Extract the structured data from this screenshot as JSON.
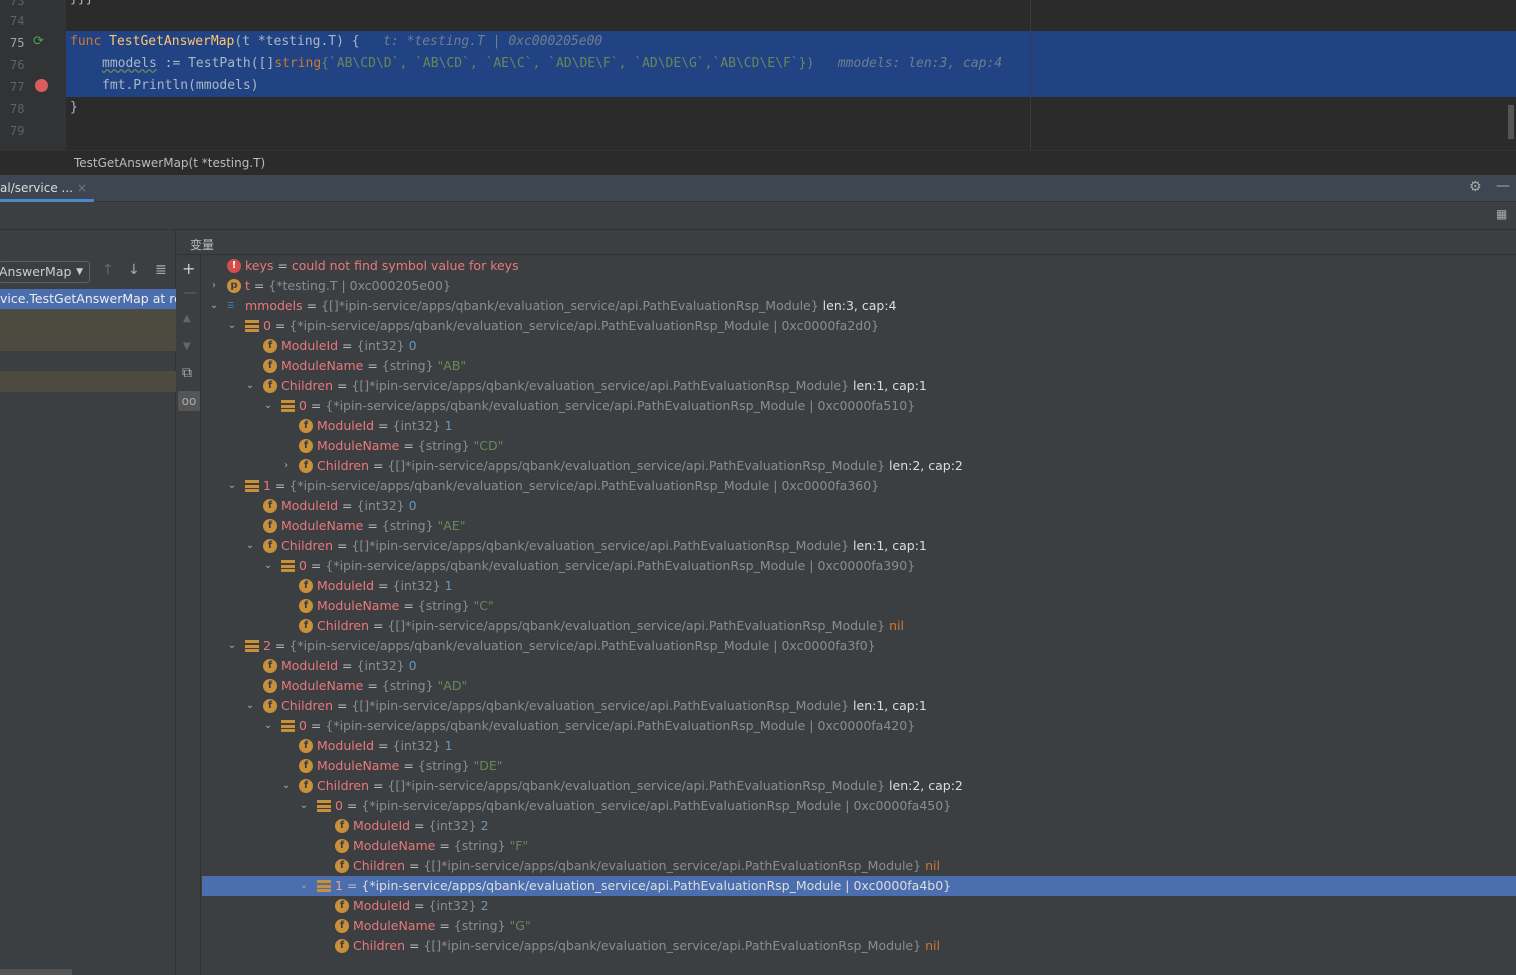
{
  "editor": {
    "lines": [
      {
        "n": "73"
      },
      {
        "n": "74"
      },
      {
        "n": "75"
      },
      {
        "n": "76"
      },
      {
        "n": "77"
      },
      {
        "n": "78"
      },
      {
        "n": "79"
      }
    ],
    "line75": {
      "kw": "func",
      "fn": "TestGetAnswerMap",
      "params": "(t *testing.T) {",
      "hint": "t: *testing.T | 0xc000205e00"
    },
    "line76": {
      "var": "mmodels",
      "op": " := TestPath([]",
      "type": "string",
      "args": "{`AB\\CD\\D`, `AB\\CD`, `AE\\C`, `AD\\DE\\F`, `AD\\DE\\G`,`AB\\CD\\E\\F`})",
      "hint": "mmodels: len:3, cap:4"
    },
    "line77": "fmt.Println(mmodels)",
    "line78": "}",
    "line73": "}}}"
  },
  "breadcrumb": "TestGetAnswerMap(t *testing.T)",
  "tab": {
    "label": "al/service ..."
  },
  "frames": {
    "thread": "AnswerMap",
    "selected_frame": "vice.TestGetAnswerMap at red"
  },
  "variables": {
    "header": "变量",
    "rows": [
      {
        "l": 0,
        "e": "none",
        "icon": "err",
        "name": "keys",
        "err": "could not find symbol value for keys"
      },
      {
        "l": 0,
        "e": "closed",
        "icon": "p",
        "name": "t",
        "type": "{*testing.T | 0xc000205e00}"
      },
      {
        "l": 0,
        "e": "open",
        "icon": "list",
        "name": "mmodels",
        "type": "{[]*ipin-service/apps/qbank/evaluation_service/api.PathEvaluationRsp_Module}",
        "extra": " len:3, cap:4"
      },
      {
        "l": 1,
        "e": "open",
        "icon": "struct",
        "name": "0",
        "type": "{*ipin-service/apps/qbank/evaluation_service/api.PathEvaluationRsp_Module | 0xc0000fa2d0}"
      },
      {
        "l": 2,
        "e": "none",
        "icon": "f",
        "name": "ModuleId",
        "type": "{int32} ",
        "value": "0",
        "vk": "vnum"
      },
      {
        "l": 2,
        "e": "none",
        "icon": "f",
        "name": "ModuleName",
        "type": "{string} ",
        "value": "\"AB\"",
        "vk": "vstr"
      },
      {
        "l": 2,
        "e": "open",
        "icon": "f",
        "name": "Children",
        "type": "{[]*ipin-service/apps/qbank/evaluation_service/api.PathEvaluationRsp_Module}",
        "extra": " len:1, cap:1"
      },
      {
        "l": 3,
        "e": "open",
        "icon": "struct",
        "name": "0",
        "type": "{*ipin-service/apps/qbank/evaluation_service/api.PathEvaluationRsp_Module | 0xc0000fa510}"
      },
      {
        "l": 4,
        "e": "none",
        "icon": "f",
        "name": "ModuleId",
        "type": "{int32} ",
        "value": "1",
        "vk": "vnum"
      },
      {
        "l": 4,
        "e": "none",
        "icon": "f",
        "name": "ModuleName",
        "type": "{string} ",
        "value": "\"CD\"",
        "vk": "vstr"
      },
      {
        "l": 4,
        "e": "closed",
        "icon": "f",
        "name": "Children",
        "type": "{[]*ipin-service/apps/qbank/evaluation_service/api.PathEvaluationRsp_Module}",
        "extra": " len:2, cap:2"
      },
      {
        "l": 1,
        "e": "open",
        "icon": "struct",
        "name": "1",
        "type": "{*ipin-service/apps/qbank/evaluation_service/api.PathEvaluationRsp_Module | 0xc0000fa360}"
      },
      {
        "l": 2,
        "e": "none",
        "icon": "f",
        "name": "ModuleId",
        "type": "{int32} ",
        "value": "0",
        "vk": "vnum"
      },
      {
        "l": 2,
        "e": "none",
        "icon": "f",
        "name": "ModuleName",
        "type": "{string} ",
        "value": "\"AE\"",
        "vk": "vstr"
      },
      {
        "l": 2,
        "e": "open",
        "icon": "f",
        "name": "Children",
        "type": "{[]*ipin-service/apps/qbank/evaluation_service/api.PathEvaluationRsp_Module}",
        "extra": " len:1, cap:1"
      },
      {
        "l": 3,
        "e": "open",
        "icon": "struct",
        "name": "0",
        "type": "{*ipin-service/apps/qbank/evaluation_service/api.PathEvaluationRsp_Module | 0xc0000fa390}"
      },
      {
        "l": 4,
        "e": "none",
        "icon": "f",
        "name": "ModuleId",
        "type": "{int32} ",
        "value": "1",
        "vk": "vnum"
      },
      {
        "l": 4,
        "e": "none",
        "icon": "f",
        "name": "ModuleName",
        "type": "{string} ",
        "value": "\"C\"",
        "vk": "vstr"
      },
      {
        "l": 4,
        "e": "none",
        "icon": "f",
        "name": "Children",
        "type": "{[]*ipin-service/apps/qbank/evaluation_service/api.PathEvaluationRsp_Module} ",
        "value": "nil",
        "vk": "vnil"
      },
      {
        "l": 1,
        "e": "open",
        "icon": "struct",
        "name": "2",
        "type": "{*ipin-service/apps/qbank/evaluation_service/api.PathEvaluationRsp_Module | 0xc0000fa3f0}"
      },
      {
        "l": 2,
        "e": "none",
        "icon": "f",
        "name": "ModuleId",
        "type": "{int32} ",
        "value": "0",
        "vk": "vnum"
      },
      {
        "l": 2,
        "e": "none",
        "icon": "f",
        "name": "ModuleName",
        "type": "{string} ",
        "value": "\"AD\"",
        "vk": "vstr"
      },
      {
        "l": 2,
        "e": "open",
        "icon": "f",
        "name": "Children",
        "type": "{[]*ipin-service/apps/qbank/evaluation_service/api.PathEvaluationRsp_Module}",
        "extra": " len:1, cap:1"
      },
      {
        "l": 3,
        "e": "open",
        "icon": "struct",
        "name": "0",
        "type": "{*ipin-service/apps/qbank/evaluation_service/api.PathEvaluationRsp_Module | 0xc0000fa420}"
      },
      {
        "l": 4,
        "e": "none",
        "icon": "f",
        "name": "ModuleId",
        "type": "{int32} ",
        "value": "1",
        "vk": "vnum"
      },
      {
        "l": 4,
        "e": "none",
        "icon": "f",
        "name": "ModuleName",
        "type": "{string} ",
        "value": "\"DE\"",
        "vk": "vstr"
      },
      {
        "l": 4,
        "e": "open",
        "icon": "f",
        "name": "Children",
        "type": "{[]*ipin-service/apps/qbank/evaluation_service/api.PathEvaluationRsp_Module}",
        "extra": " len:2, cap:2"
      },
      {
        "l": 5,
        "e": "open",
        "icon": "struct",
        "name": "0",
        "type": "{*ipin-service/apps/qbank/evaluation_service/api.PathEvaluationRsp_Module | 0xc0000fa450}"
      },
      {
        "l": 6,
        "e": "none",
        "icon": "f",
        "name": "ModuleId",
        "type": "{int32} ",
        "value": "2",
        "vk": "vnum"
      },
      {
        "l": 6,
        "e": "none",
        "icon": "f",
        "name": "ModuleName",
        "type": "{string} ",
        "value": "\"F\"",
        "vk": "vstr"
      },
      {
        "l": 6,
        "e": "none",
        "icon": "f",
        "name": "Children",
        "type": "{[]*ipin-service/apps/qbank/evaluation_service/api.PathEvaluationRsp_Module} ",
        "value": "nil",
        "vk": "vnil"
      },
      {
        "l": 5,
        "e": "open",
        "icon": "struct",
        "name": "1",
        "type": "{*ipin-service/apps/qbank/evaluation_service/api.PathEvaluationRsp_Module | 0xc0000fa4b0}",
        "selected": true
      },
      {
        "l": 6,
        "e": "none",
        "icon": "f",
        "name": "ModuleId",
        "type": "{int32} ",
        "value": "2",
        "vk": "vnum"
      },
      {
        "l": 6,
        "e": "none",
        "icon": "f",
        "name": "ModuleName",
        "type": "{string} ",
        "value": "\"G\"",
        "vk": "vstr"
      },
      {
        "l": 6,
        "e": "none",
        "icon": "f",
        "name": "Children",
        "type": "{[]*ipin-service/apps/qbank/evaluation_service/api.PathEvaluationRsp_Module} ",
        "value": "nil",
        "vk": "vnil"
      }
    ]
  }
}
